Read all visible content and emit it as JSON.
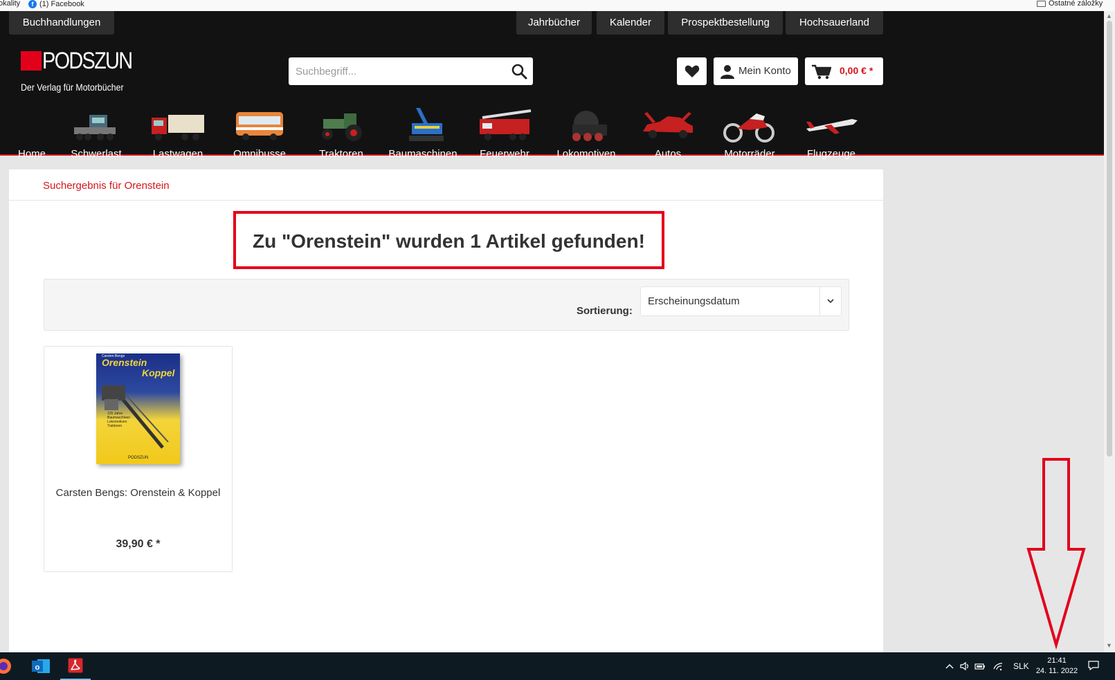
{
  "bookmarks": {
    "left_item": "okality",
    "facebook": "(1) Facebook",
    "other": "Ostatné záložky"
  },
  "header": {
    "top_left": "Buchhandlungen",
    "top_nav": [
      "Jahrbücher",
      "Kalender",
      "Prospektbestellung",
      "Hochsauerland"
    ],
    "logo_text": "PODSZUN",
    "logo_sub": "Der Verlag für Motorbücher",
    "search_placeholder": "Suchbegriff...",
    "account_label": "Mein Konto",
    "cart_total": "0,00 € *",
    "categories": [
      "Home",
      "Schwerlast",
      "Lastwagen",
      "Omnibusse",
      "Traktoren",
      "Baumaschinen",
      "Feuerwehr",
      "Lokomotiven",
      "Autos",
      "Motorräder",
      "Flugzeuge"
    ]
  },
  "main": {
    "breadcrumb": "Suchergebnis für Orenstein",
    "headline": "Zu \"Orenstein\" wurden 1 Artikel gefunden!",
    "sort_label": "Sortierung:",
    "sort_value": "Erscheinungsdatum"
  },
  "product": {
    "cover_author": "Carsten Bengs",
    "cover_title_1": "Orenstein",
    "cover_title_2": "Koppel",
    "cover_subtitle": "125 Jahre Baumaschinen Lokomotiven Traktoren",
    "cover_brand": "PODSZUN",
    "title": "Carsten Bengs: Orenstein & Koppel",
    "price": "39,90 € *"
  },
  "taskbar": {
    "language": "SLK",
    "time": "21:41",
    "date": "24. 11. 2022"
  },
  "colors": {
    "brand_red": "#d4151b",
    "header_bg": "#121212",
    "annotation_red": "#e3001b"
  }
}
